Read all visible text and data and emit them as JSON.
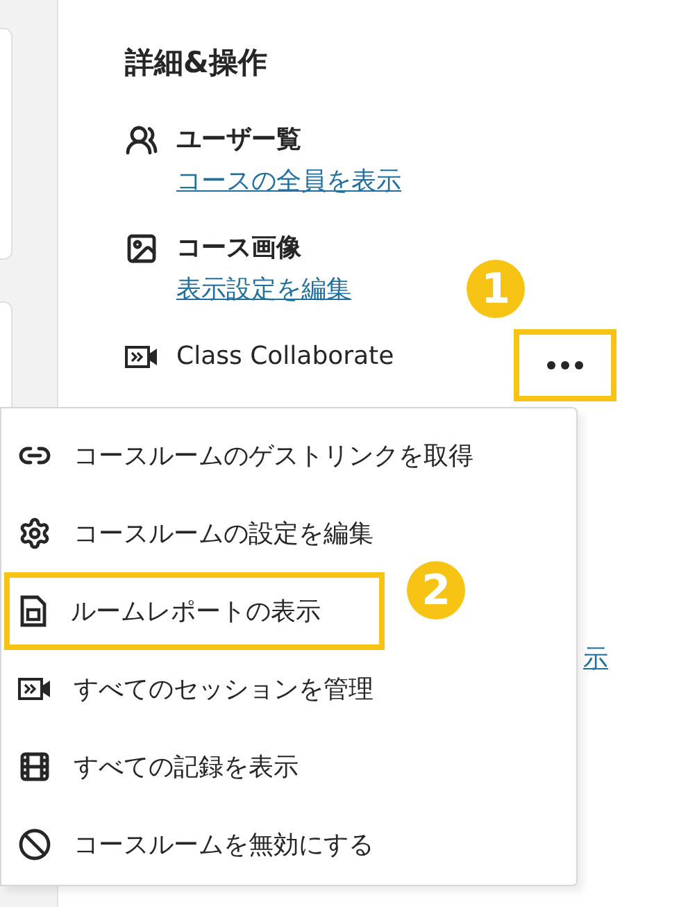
{
  "heading": "詳細&操作",
  "sections": [
    {
      "kind": "users",
      "title": "ユーザー覧",
      "link": "コースの全員を表示"
    },
    {
      "kind": "image",
      "title": "コース画像",
      "link": "表示設定を編集"
    },
    {
      "kind": "video",
      "title": "Class Collaborate"
    }
  ],
  "more_button": {
    "highlighted": true
  },
  "partial_link": "示",
  "menu": {
    "items": [
      {
        "kind": "link",
        "label": "コースルームのゲストリンクを取得",
        "highlighted": false
      },
      {
        "kind": "settings",
        "label": "コースルームの設定を編集",
        "highlighted": false
      },
      {
        "kind": "report",
        "label": "ルームレポートの表示",
        "highlighted": true
      },
      {
        "kind": "sessions",
        "label": "すべてのセッションを管理",
        "highlighted": false
      },
      {
        "kind": "recordings",
        "label": "すべての記録を表示",
        "highlighted": false
      },
      {
        "kind": "disable",
        "label": "コースルームを無効にする",
        "highlighted": false
      }
    ]
  },
  "callouts": [
    {
      "number": "1"
    },
    {
      "number": "2"
    }
  ]
}
